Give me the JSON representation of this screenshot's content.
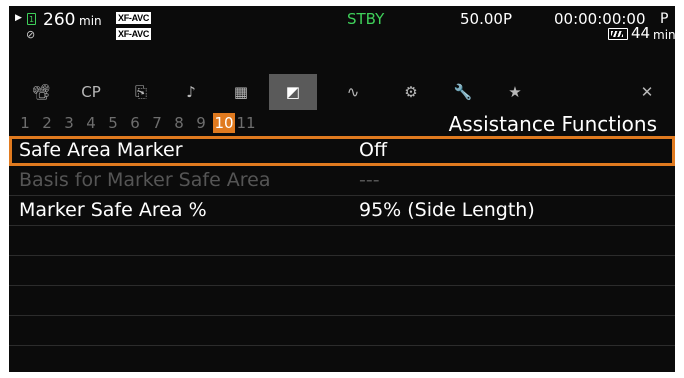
{
  "status": {
    "media_time": "260",
    "media_unit": "min",
    "format_badge_1": "XF-AVC",
    "format_badge_2": "XF-AVC",
    "mode": "STBY",
    "frame_rate": "50.00P",
    "timecode": "00:00:00:00",
    "timecode_suffix": "P",
    "battery_time": "44",
    "battery_unit": "min",
    "play_icon": "play-triangle-icon",
    "card_icon": "sd-card-slot-icon",
    "remote_icon": "remote-off-icon",
    "battery_icon": "battery-icon"
  },
  "tabs": [
    {
      "name": "tab-camera",
      "glyph": "📽",
      "icon": "camera-setup-icon"
    },
    {
      "name": "tab-custom-picture",
      "glyph": "CP",
      "icon": "custom-picture-icon"
    },
    {
      "name": "tab-recording",
      "glyph": "⎘",
      "icon": "recording-setup-icon"
    },
    {
      "name": "tab-audio",
      "glyph": "♪",
      "icon": "audio-setup-icon"
    },
    {
      "name": "tab-monitoring",
      "glyph": "▦",
      "icon": "monitoring-setup-icon"
    },
    {
      "name": "tab-assistance",
      "glyph": "◩",
      "icon": "assistance-functions-icon"
    },
    {
      "name": "tab-network",
      "glyph": "∿",
      "icon": "network-settings-icon"
    },
    {
      "name": "tab-system",
      "glyph": "⚙",
      "icon": "system-setup-icon"
    },
    {
      "name": "tab-maintenance",
      "glyph": "🔧",
      "icon": "maintenance-icon"
    },
    {
      "name": "tab-my-menu",
      "glyph": "★",
      "icon": "my-menu-star-icon"
    },
    {
      "name": "tab-close",
      "glyph": "✕",
      "icon": "close-icon"
    }
  ],
  "active_tab_index": 5,
  "pages": [
    "1",
    "2",
    "3",
    "4",
    "5",
    "6",
    "7",
    "8",
    "9",
    "10",
    "11"
  ],
  "active_page": "10",
  "section_title": "Assistance Functions",
  "menu_items": [
    {
      "label": "Safe Area Marker",
      "value": "Off",
      "selected": true,
      "enabled": true
    },
    {
      "label": "Basis for Marker Safe Area",
      "value": "---",
      "selected": false,
      "enabled": false
    },
    {
      "label": "Marker Safe Area %",
      "value": "95% (Side Length)",
      "selected": false,
      "enabled": true
    },
    {
      "label": "",
      "value": ""
    },
    {
      "label": "",
      "value": ""
    },
    {
      "label": "",
      "value": ""
    },
    {
      "label": "",
      "value": ""
    },
    {
      "label": "",
      "value": ""
    }
  ],
  "colors": {
    "accent": "#e07a1f",
    "standby": "#3fd05a",
    "background": "#0b0b0b",
    "disabled_text": "#555555"
  }
}
